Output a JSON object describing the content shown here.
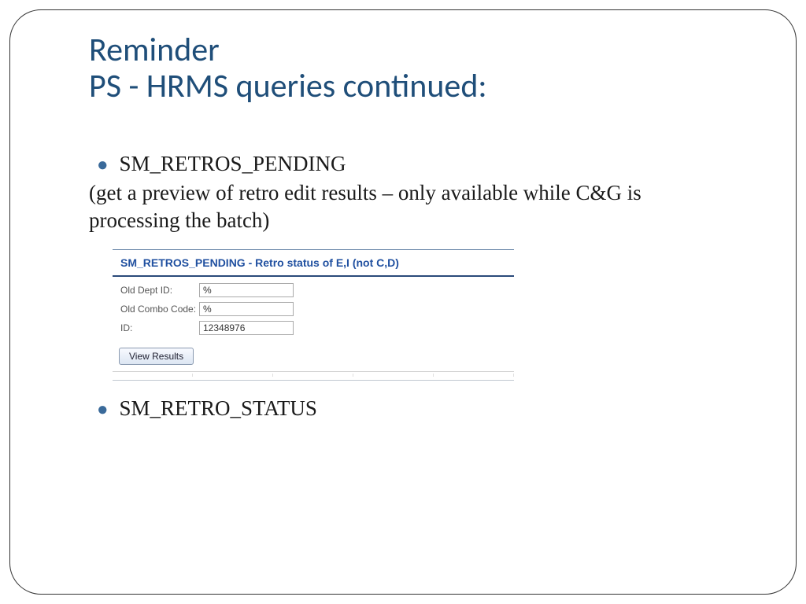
{
  "title": {
    "line1": "Reminder",
    "line2": "PS - HRMS queries continued:"
  },
  "bullets": {
    "item1": "SM_RETROS_PENDING",
    "item1_desc": "(get a preview of retro edit results – only available while C&G is processing the batch)",
    "item2": "SM_RETRO_STATUS"
  },
  "panel": {
    "title": "SM_RETROS_PENDING - Retro status of E,I (not C,D)",
    "fields": {
      "old_dept_label": "Old Dept ID:",
      "old_dept_value": "%",
      "old_combo_label": "Old Combo Code:",
      "old_combo_value": "%",
      "id_label": "ID:",
      "id_value": "12348976"
    },
    "button": "View Results"
  }
}
